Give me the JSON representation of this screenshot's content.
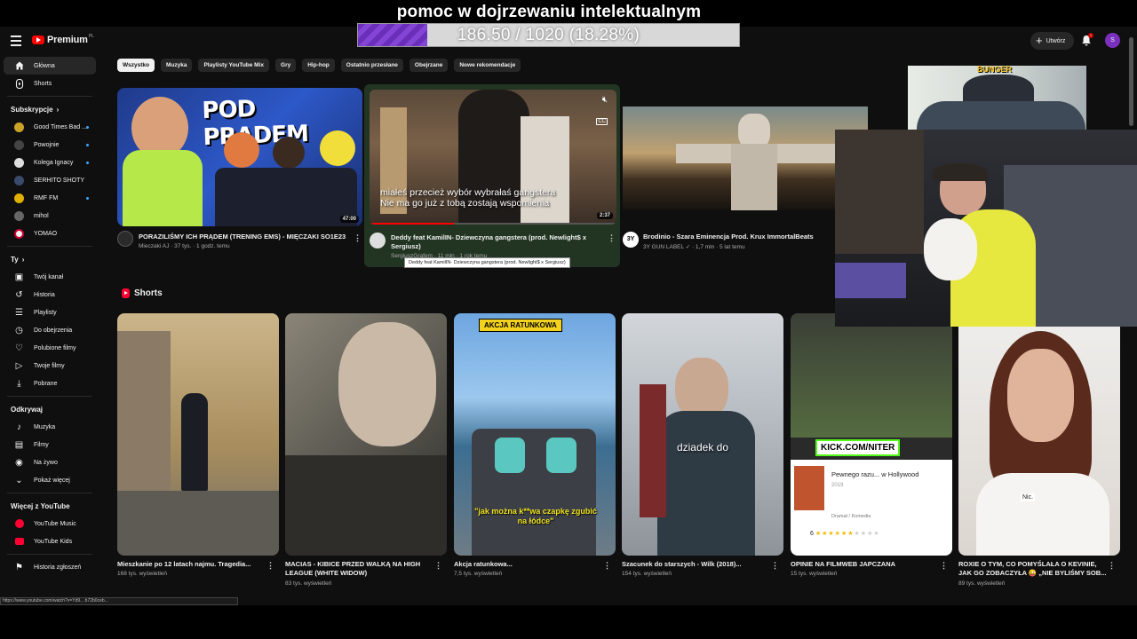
{
  "overlay": {
    "title": "pomoc w dojrzewaniu intelektualnym",
    "progress_text": "186.50 / 1020 (18.28%)",
    "progress_fraction": 0.1828
  },
  "header": {
    "logo_text": "Premium",
    "logo_superscript": "PL",
    "create_label": "Utwórz",
    "notification_count": "1",
    "avatar_letter": "S"
  },
  "sidebar": {
    "main": [
      {
        "label": "Główna",
        "icon": "home-icon"
      },
      {
        "label": "Shorts",
        "icon": "shorts-icon"
      }
    ],
    "subscriptions_header": "Subskrypcje",
    "subscriptions": [
      {
        "label": "Good Times Bad ...",
        "color": "#c9a227"
      },
      {
        "label": "Powojnie",
        "color": "#444444"
      },
      {
        "label": "Kolega Ignacy",
        "color": "#dddddd"
      },
      {
        "label": "SERHITO SHOTY",
        "color": "#3a4a6a"
      },
      {
        "label": "RMF FM",
        "color": "#e0b000"
      },
      {
        "label": "mihol",
        "color": "#666666"
      },
      {
        "label": "YOMAO",
        "color": "#f4f4f4"
      }
    ],
    "you_header": "Ty",
    "you": [
      {
        "label": "Twój kanał",
        "icon": "channel-icon"
      },
      {
        "label": "Historia",
        "icon": "history-icon"
      },
      {
        "label": "Playlisty",
        "icon": "playlist-icon"
      },
      {
        "label": "Do obejrzenia",
        "icon": "watch-later-icon"
      },
      {
        "label": "Polubione filmy",
        "icon": "like-icon"
      },
      {
        "label": "Twoje filmy",
        "icon": "your-videos-icon"
      },
      {
        "label": "Pobrane",
        "icon": "download-icon"
      }
    ],
    "explore_header": "Odkrywaj",
    "explore": [
      {
        "label": "Muzyka",
        "icon": "music-icon"
      },
      {
        "label": "Filmy",
        "icon": "film-icon"
      },
      {
        "label": "Na żywo",
        "icon": "live-icon"
      },
      {
        "label": "Pokaż więcej",
        "icon": "chevron-down-icon"
      }
    ],
    "more_header": "Więcej z YouTube",
    "more": [
      {
        "label": "YouTube Music",
        "icon": "youtube-music-icon"
      },
      {
        "label": "YouTube Kids",
        "icon": "youtube-kids-icon"
      }
    ],
    "report_history": "Historia zgłoszeń"
  },
  "chips": [
    "Wszystko",
    "Muzyka",
    "Playlisty YouTube Mix",
    "Gry",
    "Hip-hop",
    "Ostatnio przesłane",
    "Obejrzane",
    "Nowe rekomendacje"
  ],
  "videos": [
    {
      "title": "PORAZILIŚMY ICH PRĄDEM (TRENING EMS) - MIĘCZAKI SO1E23",
      "channel": "Mieczaki AJ",
      "meta": "37 tys. · 1 godz. temu",
      "duration": "47:00",
      "thumb_text": "POD PRĄDEM"
    },
    {
      "title": "Deddy feat KamilIN- Dziewczyna gangstera (prod. Newlight$ x Sergiusz)",
      "channel": "SergiuszGrafem",
      "meta": "11 mln · 1 rok temu",
      "duration": "2:37",
      "subtitle_line1": "miałeś przecież wybór wybrałaś gangstera",
      "subtitle_line2": "Nie ma go już z tobą zostają wspomienia",
      "tooltip": "Deddy feat KamilIN- Dziewczyna gangstera (prod. Newlight$ x Sergiusz)",
      "cc_label": "CC"
    },
    {
      "title": "Brodinio - Szara Eminencja Prod. Krux ImmortalBeats",
      "channel": "3Y GUN LABEL",
      "meta": "1,7 mln · 5 lat temu",
      "channel_icon_text": "3Y"
    }
  ],
  "shorts_header": "Shorts",
  "shorts": [
    {
      "title": "Mieszkanie po 12 latach najmu. Tragedia...",
      "views": "168 tys. wyświetleń"
    },
    {
      "title": "MACIAS - KIBICE PRZED WALKĄ NA HIGH LEAGUE (WHITE WIDOW)",
      "views": "83 tys. wyświetleń"
    },
    {
      "title": "Akcja ratunkowa...",
      "views": "7,5 tys. wyświetleń",
      "banner": "AKCJA RATUNKOWA",
      "caption": "\"jak można k**wa czapkę zgubić na łódce\""
    },
    {
      "title": "Szacunek do starszych - Wilk (2018)...",
      "views": "154 tys. wyświetleń",
      "caption": "dziadek do"
    },
    {
      "title": "OPINIE NA FILMWEB JAPCZANA",
      "views": "15 tys. wyświetleń",
      "kick": "KICK.COM/NITER",
      "movie_title": "Pewnego razu... w Hollywood",
      "movie_year": "2019",
      "movie_meta": "Dramat / Komedia",
      "rating": "6"
    },
    {
      "title": "ROXIE O TYM, CO POMYŚLAŁA O KEVINIE, JAK GO ZOBACZYŁA 😜 „NIE BYLIŚMY SOB...",
      "views": "89 tys. wyświetleń",
      "badge": "Nic."
    }
  ],
  "webcam": {
    "sign_text": "BUNGER"
  },
  "status_url": "https://www.youtube.com/watch?v=Yd9... b72b0ceb..."
}
